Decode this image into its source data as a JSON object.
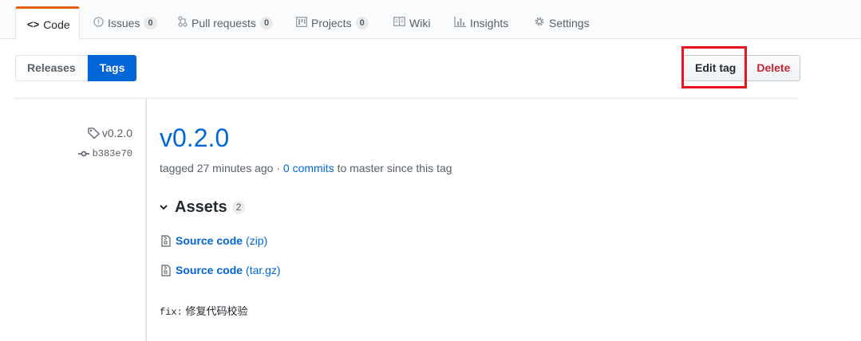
{
  "nav": {
    "tabs": [
      {
        "label": "Code",
        "icon": "code-icon"
      },
      {
        "label": "Issues",
        "count": "0",
        "icon": "issue-icon"
      },
      {
        "label": "Pull requests",
        "count": "0",
        "icon": "git-pull-request-icon"
      },
      {
        "label": "Projects",
        "count": "0",
        "icon": "project-icon"
      },
      {
        "label": "Wiki",
        "icon": "book-icon"
      },
      {
        "label": "Insights",
        "icon": "graph-icon"
      },
      {
        "label": "Settings",
        "icon": "gear-icon"
      }
    ],
    "selected": "Code",
    "accent": "#e36209"
  },
  "subnav": {
    "releases_label": "Releases",
    "tags_label": "Tags"
  },
  "actions": {
    "edit_label": "Edit tag",
    "delete_label": "Delete",
    "highlight_color": "#e8131f"
  },
  "meta": {
    "tag": "v0.2.0",
    "commit": "b383e70"
  },
  "release": {
    "title": "v0.2.0",
    "tagged_text": "tagged 27 minutes ago ·",
    "commits_link": "0 commits",
    "since_text": "to master since this tag",
    "link_color": "#0366d6"
  },
  "assets": {
    "title": "Assets",
    "count": "2",
    "items": [
      {
        "name": "Source code",
        "ext": "(zip)"
      },
      {
        "name": "Source code",
        "ext": "(tar.gz)"
      }
    ]
  },
  "note": {
    "prefix": "fix:",
    "text": "修复代码校验"
  }
}
